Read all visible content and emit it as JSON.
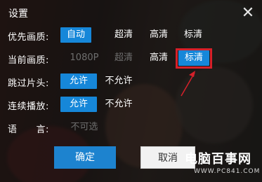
{
  "dialog": {
    "title": "设置",
    "close_symbol": "✕"
  },
  "rows": {
    "preferred_quality": {
      "label": "优先画质:",
      "options": [
        "自动",
        "超清",
        "高清",
        "标清"
      ],
      "selected": "自动"
    },
    "current_quality": {
      "label": "当前画质:",
      "options": [
        "1080P",
        "超清",
        "高清",
        "标清"
      ],
      "disabled": [
        "1080P",
        "超清"
      ],
      "selected": "标清"
    },
    "skip_intro": {
      "label": "跳过片头:",
      "options": [
        "允许",
        "不允许"
      ],
      "selected": "允许"
    },
    "autoplay": {
      "label": "连续播放:",
      "options": [
        "允许",
        "不允许"
      ],
      "selected": "允许"
    },
    "language": {
      "label": "语　　言:",
      "value": "不可选"
    }
  },
  "buttons": {
    "ok": "确定",
    "cancel": "取消"
  },
  "watermark": {
    "text": "电脑百事网",
    "url": "WWW.PC841.COM"
  },
  "colors": {
    "accent": "#1687d9",
    "highlight": "#d6202a"
  }
}
